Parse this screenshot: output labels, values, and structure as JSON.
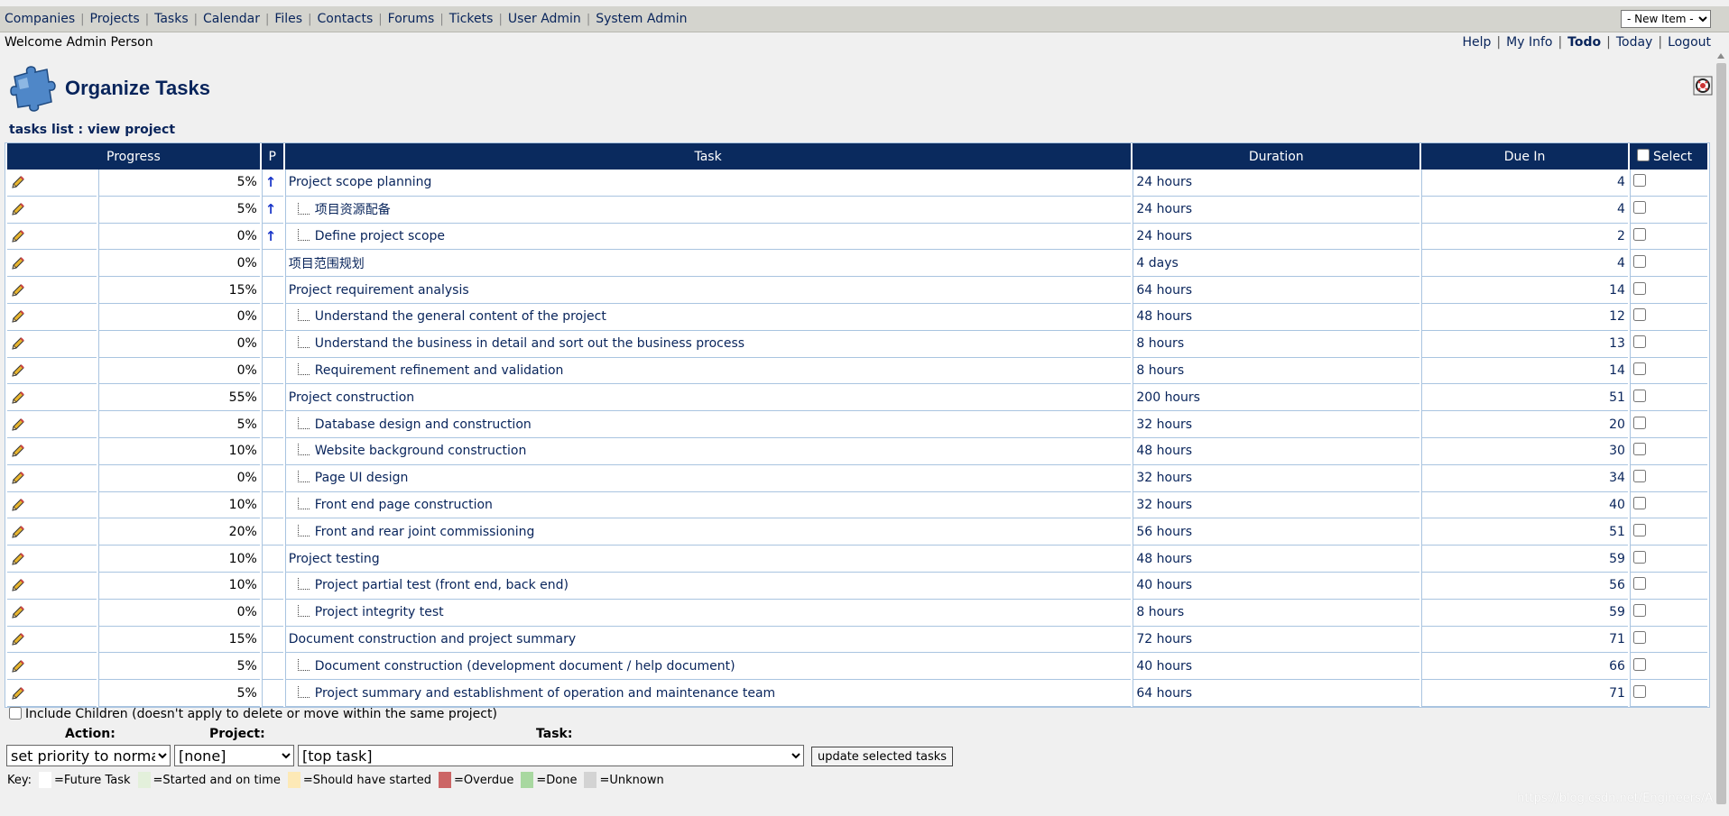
{
  "menu": [
    "Companies",
    "Projects",
    "Tasks",
    "Calendar",
    "Files",
    "Contacts",
    "Forums",
    "Tickets",
    "User Admin",
    "System Admin"
  ],
  "new_item": "- New Item -",
  "welcome": "Welcome Admin Person",
  "top_links": {
    "help": "Help",
    "myinfo": "My Info",
    "todo": "Todo",
    "today": "Today",
    "logout": "Logout"
  },
  "page_title": "Organize Tasks",
  "breadcrumb": "tasks list : view project",
  "columns": {
    "progress": "Progress",
    "p": "P",
    "task": "Task",
    "duration": "Duration",
    "due": "Due In",
    "select": "Select"
  },
  "rows": [
    {
      "progress": "5%",
      "priority": true,
      "child": false,
      "task": "Project scope planning",
      "duration": "24 hours",
      "due": "4"
    },
    {
      "progress": "5%",
      "priority": true,
      "child": true,
      "task": "项目资源配备",
      "duration": "24 hours",
      "due": "4"
    },
    {
      "progress": "0%",
      "priority": true,
      "child": true,
      "task": "Define project scope",
      "duration": "24 hours",
      "due": "2"
    },
    {
      "progress": "0%",
      "priority": false,
      "child": false,
      "task": "项目范围规划",
      "duration": "4 days",
      "due": "4"
    },
    {
      "progress": "15%",
      "priority": false,
      "child": false,
      "task": "Project requirement analysis",
      "duration": "64 hours",
      "due": "14"
    },
    {
      "progress": "0%",
      "priority": false,
      "child": true,
      "task": "Understand the general content of the project",
      "duration": "48 hours",
      "due": "12"
    },
    {
      "progress": "0%",
      "priority": false,
      "child": true,
      "task": "Understand the business in detail and sort out the business process",
      "duration": "8 hours",
      "due": "13"
    },
    {
      "progress": "0%",
      "priority": false,
      "child": true,
      "task": "Requirement refinement and validation",
      "duration": "8 hours",
      "due": "14"
    },
    {
      "progress": "55%",
      "priority": false,
      "child": false,
      "task": "Project construction",
      "duration": "200 hours",
      "due": "51"
    },
    {
      "progress": "5%",
      "priority": false,
      "child": true,
      "task": "Database design and construction",
      "duration": "32 hours",
      "due": "20"
    },
    {
      "progress": "10%",
      "priority": false,
      "child": true,
      "task": "Website background construction",
      "duration": "48 hours",
      "due": "30"
    },
    {
      "progress": "0%",
      "priority": false,
      "child": true,
      "task": "Page UI design",
      "duration": "32 hours",
      "due": "34"
    },
    {
      "progress": "10%",
      "priority": false,
      "child": true,
      "task": "Front end page construction",
      "duration": "32 hours",
      "due": "40"
    },
    {
      "progress": "20%",
      "priority": false,
      "child": true,
      "task": "Front and rear joint commissioning",
      "duration": "56 hours",
      "due": "51"
    },
    {
      "progress": "10%",
      "priority": false,
      "child": false,
      "task": "Project testing",
      "duration": "48 hours",
      "due": "59"
    },
    {
      "progress": "10%",
      "priority": false,
      "child": true,
      "task": "Project partial test (front end, back end)",
      "duration": "40 hours",
      "due": "56"
    },
    {
      "progress": "0%",
      "priority": false,
      "child": true,
      "task": "Project integrity test",
      "duration": "8 hours",
      "due": "59"
    },
    {
      "progress": "15%",
      "priority": false,
      "child": false,
      "task": "Document construction and project summary",
      "duration": "72 hours",
      "due": "71"
    },
    {
      "progress": "5%",
      "priority": false,
      "child": true,
      "task": "Document construction (development document / help document)",
      "duration": "40 hours",
      "due": "66"
    },
    {
      "progress": "5%",
      "priority": false,
      "child": true,
      "task": "Project summary and establishment of operation and maintenance team",
      "duration": "64 hours",
      "due": "71"
    }
  ],
  "include_children": "Include Children (doesn't apply to delete or move within the same project)",
  "labels": {
    "action": "Action:",
    "project": "Project:",
    "task": "Task:"
  },
  "action_value": "set priority to normal",
  "project_value": "[none]",
  "task_value": "[top task]",
  "update_button": "update selected tasks",
  "key": {
    "label": "Key:",
    "items": [
      {
        "color": "#ffffff",
        "text": "=Future Task"
      },
      {
        "color": "#e3f0db",
        "text": "=Started and on time"
      },
      {
        "color": "#fde9b6",
        "text": "=Should have started"
      },
      {
        "color": "#cc6666",
        "text": "=Overdue"
      },
      {
        "color": "#a8d8a0",
        "text": "=Done"
      },
      {
        "color": "#d3d3d3",
        "text": "=Unknown"
      }
    ]
  },
  "watermark": "https://blog.csdn.net/Engineers/AI"
}
